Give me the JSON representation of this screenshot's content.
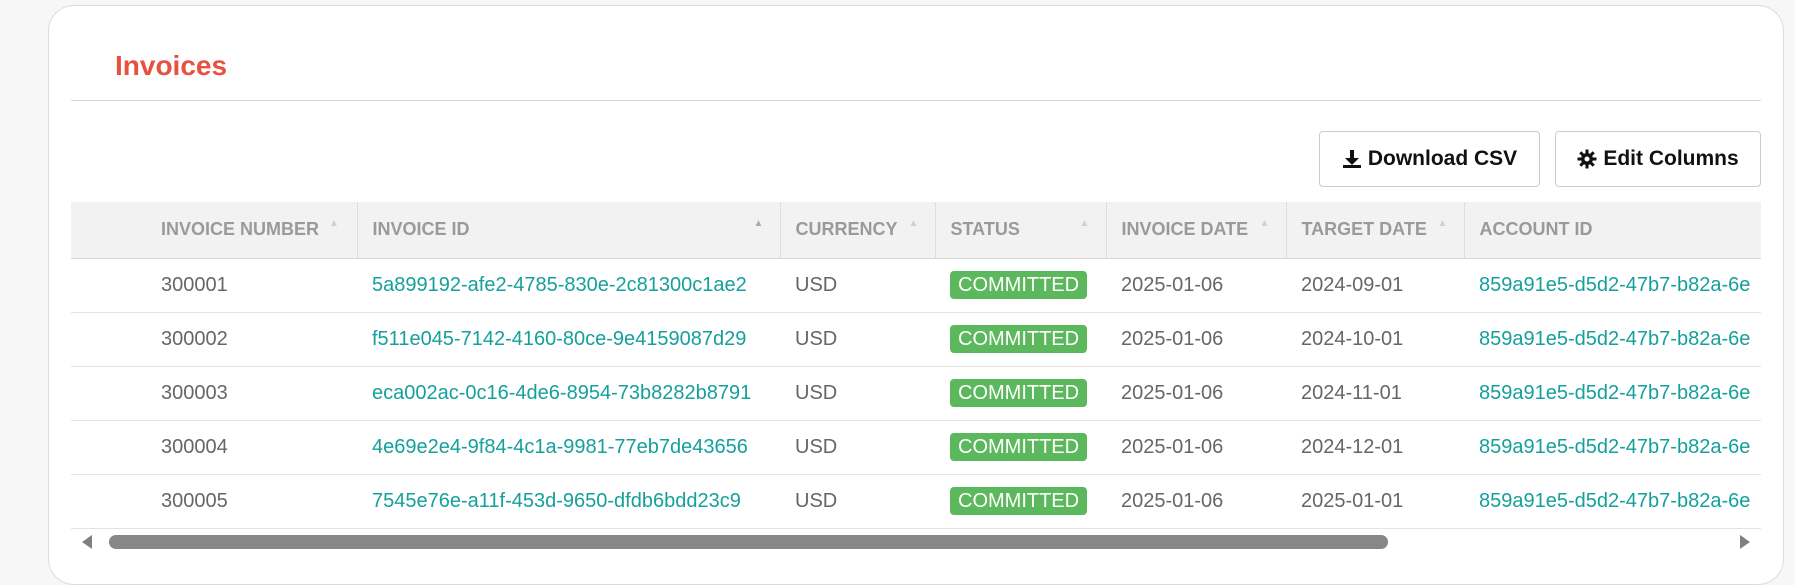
{
  "page": {
    "title": "Invoices"
  },
  "toolbar": {
    "download_csv_label": "Download CSV",
    "edit_columns_label": "Edit Columns"
  },
  "table": {
    "columns": [
      "INVOICE NUMBER",
      "INVOICE ID",
      "CURRENCY",
      "STATUS",
      "INVOICE DATE",
      "TARGET DATE",
      "ACCOUNT ID"
    ],
    "rows": [
      {
        "invoice_number": "300001",
        "invoice_id": "5a899192-afe2-4785-830e-2c81300c1ae2",
        "currency": "USD",
        "status": "COMMITTED",
        "invoice_date": "2025-01-06",
        "target_date": "2024-09-01",
        "account_id": "859a91e5-d5d2-47b7-b82a-6e"
      },
      {
        "invoice_number": "300002",
        "invoice_id": "f511e045-7142-4160-80ce-9e4159087d29",
        "currency": "USD",
        "status": "COMMITTED",
        "invoice_date": "2025-01-06",
        "target_date": "2024-10-01",
        "account_id": "859a91e5-d5d2-47b7-b82a-6e"
      },
      {
        "invoice_number": "300003",
        "invoice_id": "eca002ac-0c16-4de6-8954-73b8282b8791",
        "currency": "USD",
        "status": "COMMITTED",
        "invoice_date": "2025-01-06",
        "target_date": "2024-11-01",
        "account_id": "859a91e5-d5d2-47b7-b82a-6e"
      },
      {
        "invoice_number": "300004",
        "invoice_id": "4e69e2e4-9f84-4c1a-9981-77eb7de43656",
        "currency": "USD",
        "status": "COMMITTED",
        "invoice_date": "2025-01-06",
        "target_date": "2024-12-01",
        "account_id": "859a91e5-d5d2-47b7-b82a-6e"
      },
      {
        "invoice_number": "300005",
        "invoice_id": "7545e76e-a11f-453d-9650-dfdb6bdd23c9",
        "currency": "USD",
        "status": "COMMITTED",
        "invoice_date": "2025-01-06",
        "target_date": "2025-01-01",
        "account_id": "859a91e5-d5d2-47b7-b82a-6e"
      }
    ]
  },
  "colors": {
    "title": "#e8503f",
    "link": "#15a09b",
    "status_committed": "#5cb85c"
  },
  "icons": {
    "download": "download-icon",
    "edit_columns": "gear-icon"
  }
}
